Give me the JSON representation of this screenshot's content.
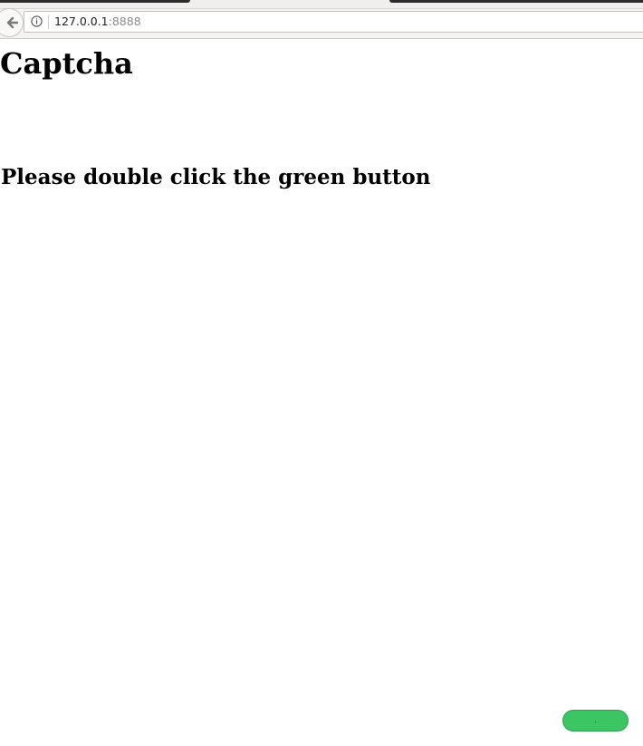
{
  "browser": {
    "url_host": "127.0.0.1",
    "url_port": ":8888",
    "back_icon": "back-arrow-icon",
    "info_icon": "info-icon"
  },
  "page": {
    "title": "Captcha",
    "instruction": "Please double click the green button"
  },
  "captcha_button": {
    "label": ".",
    "color": "#3cc563"
  }
}
